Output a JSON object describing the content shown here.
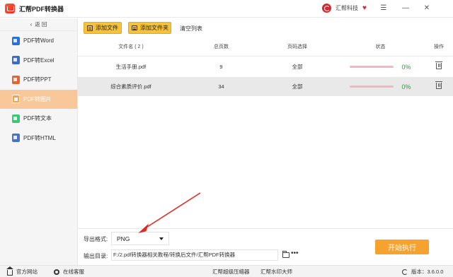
{
  "window": {
    "title": "汇帮PDF转换器",
    "brand": "汇帮科技",
    "heart_icon": "heart-icon",
    "controls": [
      "menu-icon",
      "minimize-icon",
      "close-icon"
    ]
  },
  "sidebar": {
    "back_label": "返 回",
    "items": [
      {
        "label": "PDF转Word",
        "icon": "word-icon"
      },
      {
        "label": "PDF转Excel",
        "icon": "excel-icon"
      },
      {
        "label": "PDF转PPT",
        "icon": "ppt-icon"
      },
      {
        "label": "PDF转图片",
        "icon": "image-icon",
        "active": true
      },
      {
        "label": "PDF转文本",
        "icon": "text-icon"
      },
      {
        "label": "PDF转HTML",
        "icon": "html-icon"
      }
    ]
  },
  "toolbar": {
    "add_file": "添加文件",
    "add_folder": "添加文件夹",
    "clear_list": "清空列表"
  },
  "table": {
    "headers": {
      "name": "文件名 ( 2 )",
      "pages": "总页数",
      "range": "页码选择",
      "status": "状态",
      "op": "操作"
    },
    "rows": [
      {
        "name": "生活手册.pdf",
        "pages": "9",
        "range": "全部",
        "progress_pct": "0%",
        "progress": 0
      },
      {
        "name": "综合素质评价.pdf",
        "pages": "34",
        "range": "全部",
        "progress_pct": "0%",
        "progress": 0
      }
    ]
  },
  "export": {
    "format_label": "导出格式:",
    "format_value": "PNG",
    "dir_label": "输出目录:",
    "dir_value": "F:/2.pdf转换器相关教程/转换后文件/汇帮PDF转换器",
    "start_button": "开始执行"
  },
  "statusbar": {
    "website": "官方网站",
    "service": "在线客服",
    "link1": "汇帮超级压缩器",
    "link2": "汇帮水印大师",
    "version": "版本：3.6.0.0"
  },
  "colors": {
    "accent": "#f6c23a",
    "active_menu": "#f8c79a",
    "start_button": "#f7a22e",
    "progress_text": "#1fa339",
    "annotation_arrow": "#e02a24"
  }
}
